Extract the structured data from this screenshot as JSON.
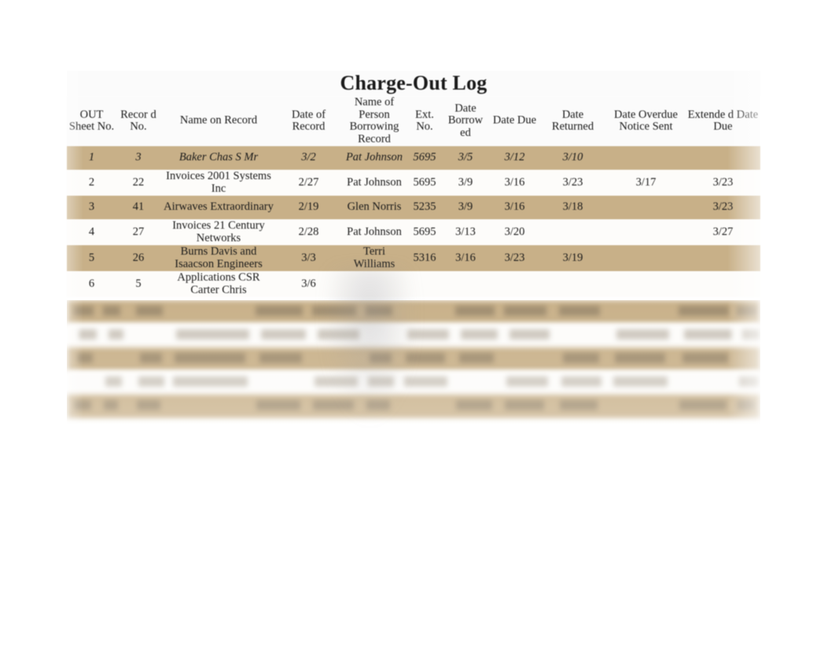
{
  "document": {
    "title": "Charge-Out Log",
    "paper_color": "#ffffff",
    "row_band_color": "#c8b088",
    "row_alt_color": "#fdfcfa"
  },
  "table": {
    "columns": [
      {
        "key": "out_sheet_no",
        "label": "OUT Sheet No."
      },
      {
        "key": "record_no",
        "label": "Recor d No."
      },
      {
        "key": "name_on_record",
        "label": "Name on Record"
      },
      {
        "key": "date_of_record",
        "label": "Date of Record"
      },
      {
        "key": "borrower_name",
        "label": "Name of Person Borrowing Record"
      },
      {
        "key": "ext_no",
        "label": "Ext. No."
      },
      {
        "key": "date_borrowed",
        "label": "Date Borrow ed"
      },
      {
        "key": "date_due",
        "label": "Date Due"
      },
      {
        "key": "date_returned",
        "label": "Date Returned"
      },
      {
        "key": "overdue_notice_sent",
        "label": "Date Overdue Notice Sent"
      },
      {
        "key": "extended_date_due",
        "label": "Extende d Date Due"
      }
    ],
    "rows": [
      {
        "out_sheet_no": "1",
        "record_no": "3",
        "name_on_record": "Baker Chas S Mr",
        "date_of_record": "3/2",
        "borrower_name": "Pat Johnson",
        "ext_no": "5695",
        "date_borrowed": "3/5",
        "date_due": "3/12",
        "date_returned": "3/10",
        "overdue_notice_sent": "",
        "extended_date_due": "",
        "style": "italic",
        "band": "tan"
      },
      {
        "out_sheet_no": "2",
        "record_no": "22",
        "name_on_record": "Invoices 2001 Systems Inc",
        "date_of_record": "2/27",
        "borrower_name": "Pat Johnson",
        "ext_no": "5695",
        "date_borrowed": "3/9",
        "date_due": "3/16",
        "date_returned": "3/23",
        "overdue_notice_sent": "3/17",
        "extended_date_due": "3/23",
        "style": "normal",
        "band": "white"
      },
      {
        "out_sheet_no": "3",
        "record_no": "41",
        "name_on_record": "Airwaves Extraordinary",
        "date_of_record": "2/19",
        "borrower_name": "Glen Norris",
        "ext_no": "5235",
        "date_borrowed": "3/9",
        "date_due": "3/16",
        "date_returned": "3/18",
        "overdue_notice_sent": "",
        "extended_date_due": "3/23",
        "style": "normal",
        "band": "tan"
      },
      {
        "out_sheet_no": "4",
        "record_no": "27",
        "name_on_record": "Invoices 21 Century Networks",
        "date_of_record": "2/28",
        "borrower_name": "Pat Johnson",
        "ext_no": "5695",
        "date_borrowed": "3/13",
        "date_due": "3/20",
        "date_returned": "",
        "overdue_notice_sent": "",
        "extended_date_due": "3/27",
        "style": "normal",
        "band": "white"
      },
      {
        "out_sheet_no": "5",
        "record_no": "26",
        "name_on_record": "Burns Davis and Isaacson Engineers",
        "date_of_record": "3/3",
        "borrower_name": "Terri Williams",
        "ext_no": "5316",
        "date_borrowed": "3/16",
        "date_due": "3/23",
        "date_returned": "3/19",
        "overdue_notice_sent": "",
        "extended_date_due": "",
        "style": "normal",
        "band": "tan"
      },
      {
        "out_sheet_no": "6",
        "record_no": "5",
        "name_on_record": "Applications CSR Carter Chris",
        "date_of_record": "3/6",
        "borrower_name": "",
        "ext_no": "",
        "date_borrowed": "",
        "date_due": "",
        "date_returned": "",
        "overdue_notice_sent": "",
        "extended_date_due": "",
        "style": "normal",
        "band": "white"
      }
    ],
    "illegible_trailing_rows": 5
  }
}
